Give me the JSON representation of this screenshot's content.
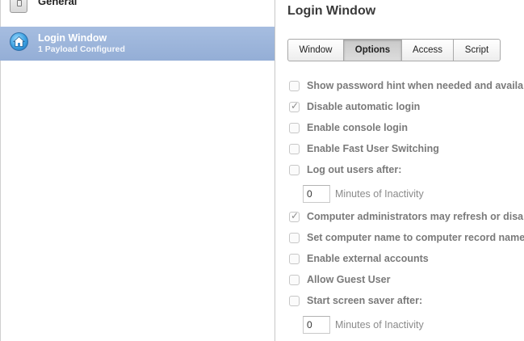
{
  "sidebar": {
    "items": [
      {
        "label": "General"
      },
      {
        "title": "Login Window",
        "subtitle": "1 Payload Configured"
      }
    ]
  },
  "main": {
    "title": "Login Window",
    "tabs": [
      {
        "label": "Window",
        "active": false
      },
      {
        "label": "Options",
        "active": true
      },
      {
        "label": "Access",
        "active": false
      },
      {
        "label": "Script",
        "active": false
      }
    ],
    "options": [
      {
        "label": "Show password hint when needed and available",
        "checked": false
      },
      {
        "label": "Disable automatic login",
        "checked": true
      },
      {
        "label": "Enable console login",
        "checked": false
      },
      {
        "label": "Enable Fast User Switching",
        "checked": false
      },
      {
        "label": "Log out users after:",
        "checked": false
      },
      {
        "label": "Computer administrators may refresh or disable management",
        "checked": true
      },
      {
        "label": "Set computer name to computer record name",
        "checked": false
      },
      {
        "label": "Enable external accounts",
        "checked": false
      },
      {
        "label": "Allow Guest User",
        "checked": false
      },
      {
        "label": "Start screen saver after:",
        "checked": false
      }
    ],
    "logout_minutes": {
      "value": "0",
      "label": "Minutes of Inactivity"
    },
    "screensaver_minutes": {
      "value": "0",
      "label": "Minutes of Inactivity"
    }
  },
  "colors": {
    "selection": "#9db6dc",
    "label_disabled": "#7a7a7a"
  }
}
